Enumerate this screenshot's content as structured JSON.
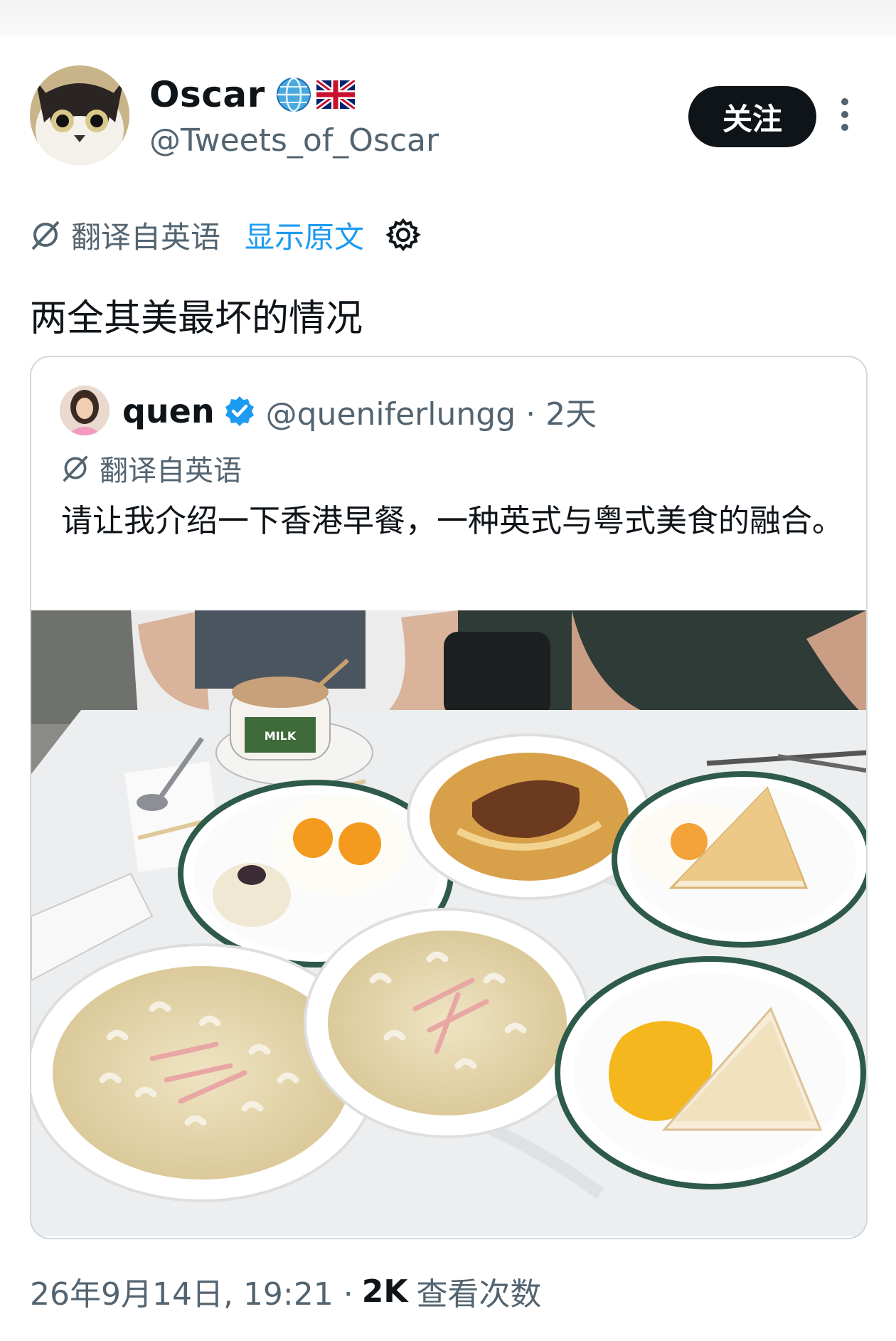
{
  "author": {
    "display_name": "Oscar",
    "handle": "@Tweets_of_Oscar",
    "badges": [
      "globe-emoji-icon",
      "uk-flag-icon"
    ]
  },
  "follow_label": "关注",
  "translation_bar": {
    "translated_from": "翻译自英语",
    "show_original": "显示原文"
  },
  "tweet_text": "两全其美最坏的情况",
  "quote": {
    "display_name": "quen",
    "handle": "@queniferlungg · 2天",
    "translated_from": "翻译自英语",
    "text": "请让我介绍一下香港早餐，一种英式与粤式美食的融合。"
  },
  "footer": {
    "timestamp": "26年9月14日, 19:21 ·",
    "views_count": "2K",
    "views_label": "查看次数"
  },
  "colors": {
    "link_blue": "#1d9bf0",
    "muted_gray": "#536471",
    "button_black": "#0f1419",
    "border": "#cfd9de",
    "plate_rim_green": "#2e5a4a"
  }
}
